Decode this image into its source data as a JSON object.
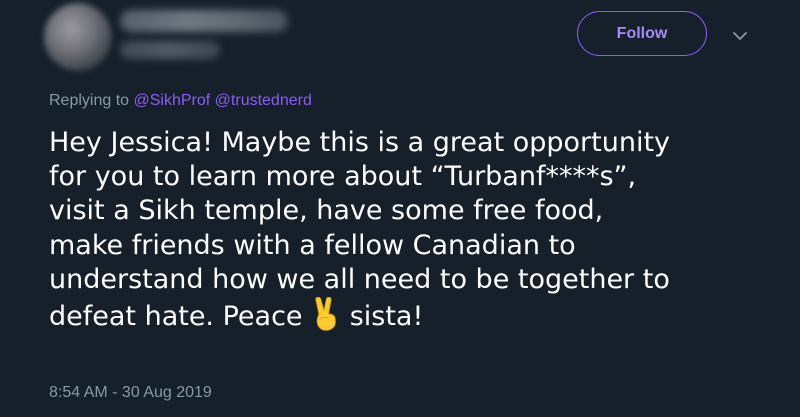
{
  "tweet": {
    "author": {
      "avatar_icon": "blurred-avatar",
      "name": "",
      "handle": ""
    },
    "follow_label": "Follow",
    "more_icon": "chevron-down-icon",
    "reply": {
      "prefix": "Replying to",
      "mention_1": "@SikhProf",
      "mention_2": "@trustednerd"
    },
    "lines": [
      "Hey Jessica! Maybe this is a great opportunity",
      "for you to learn more about “Turbanf****s”,",
      "visit a Sikh temple, have some free food,",
      "make friends with a fellow Canadian to",
      "understand how we all need to be together to"
    ],
    "last_line_before_emoji": "defeat hate. Peace ",
    "emoji_icon": "victory-hand-emoji",
    "last_line_after_emoji": " sista!",
    "timestamp": "8:54 AM - 30 Aug 2019"
  },
  "colors": {
    "background": "#15202b",
    "accent": "#8b5cf6",
    "text": "#ffffff",
    "muted": "#8899a6"
  }
}
